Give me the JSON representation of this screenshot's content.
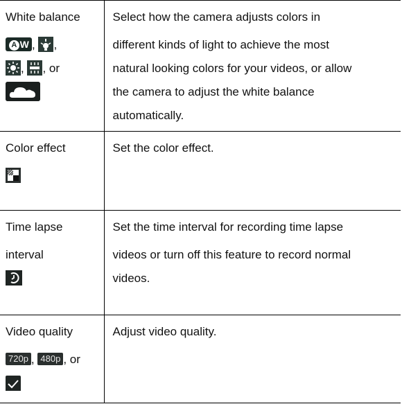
{
  "rows": [
    {
      "setting_lines": [
        "White balance"
      ],
      "white_balance_sep1": ",",
      "white_balance_sep2": ",",
      "white_balance_sep3": ",",
      "white_balance_sep4": ", or",
      "icon_aw_text": "W",
      "icon_aw_circle": "A",
      "description_lines": [
        "Select how the camera adjusts colors in",
        "different kinds of light to achieve the most",
        "natural looking colors for your videos, or allow",
        "the camera to adjust the white balance",
        "automatically."
      ]
    },
    {
      "setting_lines": [
        "Color effect"
      ],
      "description_lines": [
        "Set the color effect."
      ]
    },
    {
      "setting_lines": [
        "Time lapse",
        "interval"
      ],
      "description_lines": [
        "Set the time interval for recording time lapse",
        "videos or turn off this feature to record normal",
        "videos."
      ]
    },
    {
      "setting_lines": [
        "Video quality"
      ],
      "quality_720": "720p",
      "quality_480": "480p",
      "quality_sep1": ",",
      "quality_sep2": ", or",
      "description_lines": [
        "Adjust video quality."
      ]
    }
  ],
  "icons": [
    "auto-white-balance-icon",
    "incandescent-icon",
    "daylight-icon",
    "fluorescent-icon",
    "cloudy-icon",
    "color-effect-icon",
    "time-lapse-icon",
    "720p-quality-icon",
    "480p-quality-icon",
    "checkmark-icon"
  ],
  "colors": {
    "icon_background": "#1b2a26",
    "border": "#000000",
    "text": "#111111"
  }
}
